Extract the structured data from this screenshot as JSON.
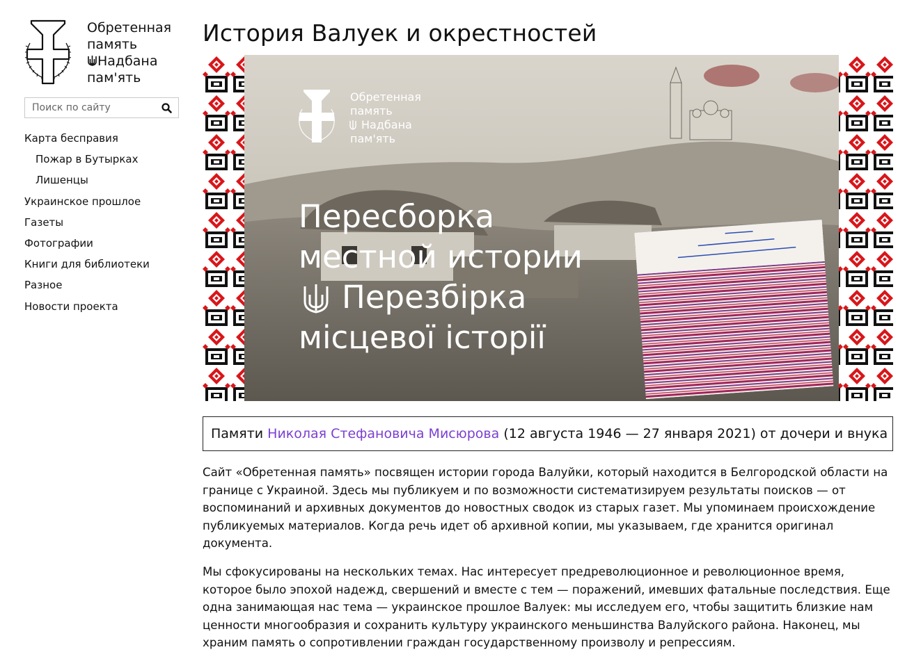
{
  "sidebar": {
    "logo": {
      "line1": "Обретенная",
      "line2": "память",
      "line3_trident": "₴",
      "line3": "Надбана",
      "line4": "пам'ять"
    },
    "search": {
      "placeholder": "Поиск по сайту",
      "icon": "search-icon"
    },
    "nav": [
      {
        "label": "Карта бесправия",
        "level": 1
      },
      {
        "label": "Пожар в Бутырках",
        "level": 2
      },
      {
        "label": "Лишенцы",
        "level": 2
      },
      {
        "label": "Украинское прошлое",
        "level": 1
      },
      {
        "label": "Газеты",
        "level": 1
      },
      {
        "label": "Фотографии",
        "level": 1
      },
      {
        "label": "Книги для библиотеки",
        "level": 1
      },
      {
        "label": "Разное",
        "level": 1
      },
      {
        "label": "Новости проекта",
        "level": 1
      }
    ]
  },
  "main": {
    "title": "История Валуек и окрестностей",
    "hero": {
      "logo_line1": "Обретенная",
      "logo_line2": "память",
      "logo_line3": "Надбана",
      "logo_line4": "пам'ять",
      "headline1": "Пересборка",
      "headline2": "местной истории",
      "headline3": "Перезбірка",
      "headline4": "місцевої історії",
      "colors": {
        "ornament_red": "#d8161a",
        "ornament_black": "#111111",
        "photo_sepia": "#8f8a80"
      }
    },
    "dedication": {
      "prefix": "Памяти",
      "link": "Николая Стефановича Мисюрова",
      "suffix": "(12 августа 1946 — 27 января 2021) от дочери и внука",
      "link_color": "#7b3fd1"
    },
    "paragraph1": "Сайт «Обретенная память» посвящен истории города Валуйки, который находится в Белгородской области на границе с Украиной. Здесь мы публикуем и по возможности систематизируем результаты поисков — от воспоминаний и архивных документов до новостных сводок из старых газет. Мы упоминаем происхождение публикуемых материалов. Когда речь идет об архивной копии, мы указываем, где хранится оригинал документа.",
    "paragraph2": "Мы сфокусированы на нескольких темах. Нас интересует предреволюционное и революционное время, которое было эпохой надежд, свершений и вместе с тем — поражений, имевших фатальные последствия. Еще одна занимающая нас тема — украинское прошлое Валуек: мы исследуем его, чтобы защитить близкие нам ценности многообразия и сохранить культуру украинского меньшинства Валуйского района. Наконец, мы храним память о сопротивлении граждан государственному произволу и репрессиям."
  }
}
